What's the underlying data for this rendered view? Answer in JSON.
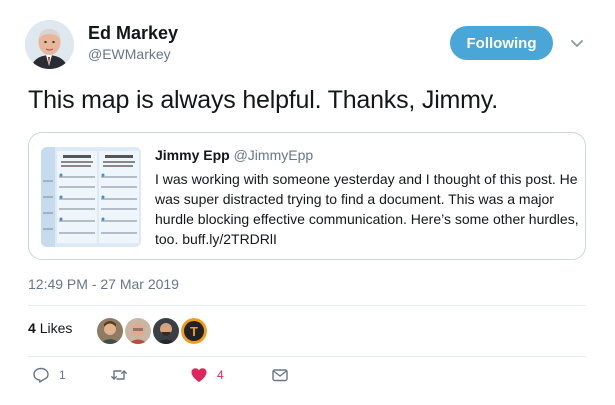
{
  "author": {
    "name": "Ed Markey",
    "handle": "@EWMarkey"
  },
  "follow_button_label": "Following",
  "tweet_text": "This map is always helpful. Thanks, Jimmy.",
  "quoted_tweet": {
    "name": "Jimmy Epp",
    "handle": "@JimmyEpp",
    "body": "I was working with someone yesterday and I thought of this post. He was super distracted trying to find a document. This was a major hurdle blocking effective communication. Here’s some other hurdles, too. buff.ly/2TRDRlI"
  },
  "timestamp": "12:49 PM - 27 Mar 2019",
  "likes": {
    "count": "4",
    "label": "Likes"
  },
  "actions": {
    "reply_count": "1",
    "retweet_count": "",
    "like_count": "4"
  },
  "colors": {
    "follow_button": "#4aa6d6",
    "like_heart": "#e0245e",
    "secondary_text": "#657786"
  },
  "icons": [
    "avatar",
    "chevron-down-icon",
    "reply-icon",
    "retweet-icon",
    "heart-icon",
    "message-icon"
  ]
}
